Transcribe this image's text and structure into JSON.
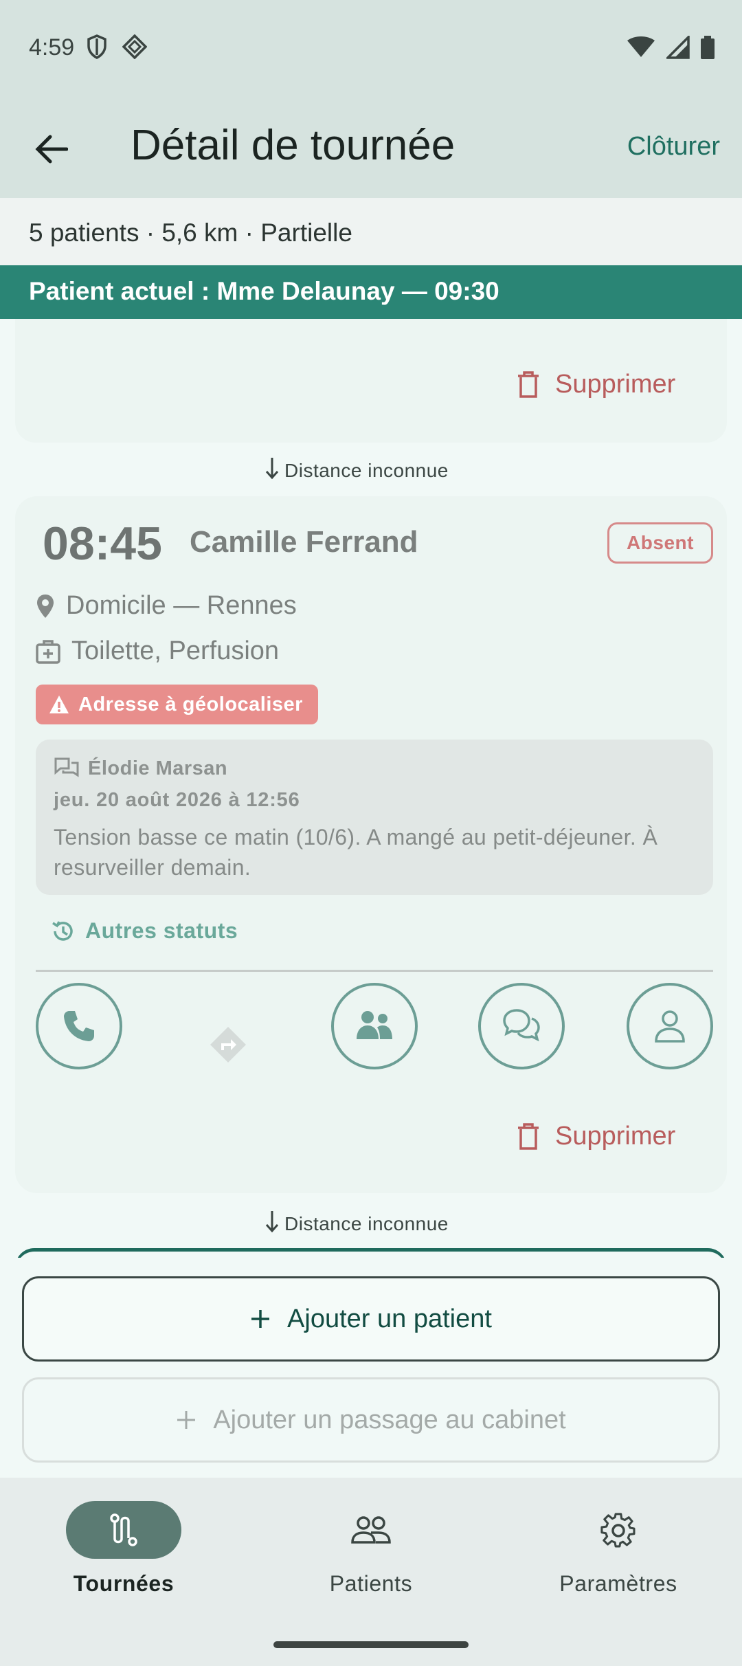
{
  "status_bar": {
    "time": "4:59"
  },
  "header": {
    "title": "Détail de tournée",
    "close_label": "Clôturer"
  },
  "summary": {
    "text": "5 patients · 5,6 km · Partielle"
  },
  "current_patient": {
    "text": "Patient actuel : Mme Delaunay — 09:30"
  },
  "previous_card": {
    "delete_label": "Supprimer"
  },
  "distances": {
    "first": "Distance inconnue",
    "second": "Distance inconnue"
  },
  "patient_card": {
    "time": "08:45",
    "name": "Camille Ferrand",
    "status_badge": "Absent",
    "location": "Domicile — Rennes",
    "care": "Toilette, Perfusion",
    "warning": "Adresse à géolocaliser",
    "note": {
      "author": "Élodie Marsan",
      "date": "jeu. 20 août 2026 à 12:56",
      "text": "Tension basse ce matin (10/6). A mangé au petit-déjeuner. À resurveiller demain."
    },
    "other_status_label": "Autres statuts",
    "delete_label": "Supprimer",
    "actions": [
      "phone-icon",
      "directions-icon",
      "family-icon",
      "chat-icon",
      "person-icon"
    ]
  },
  "buttons": {
    "add_patient": "Ajouter un patient",
    "add_cabinet": "Ajouter un passage au cabinet"
  },
  "nav": {
    "items": [
      {
        "label": "Tournées",
        "icon": "route-icon",
        "active": true
      },
      {
        "label": "Patients",
        "icon": "people-icon",
        "active": false
      },
      {
        "label": "Paramètres",
        "icon": "gear-icon",
        "active": false
      }
    ]
  },
  "colors": {
    "accent": "#2a8575",
    "app_bar": "#d6e3df",
    "danger": "#b85c5c",
    "warning_chip": "#e88e8c"
  }
}
